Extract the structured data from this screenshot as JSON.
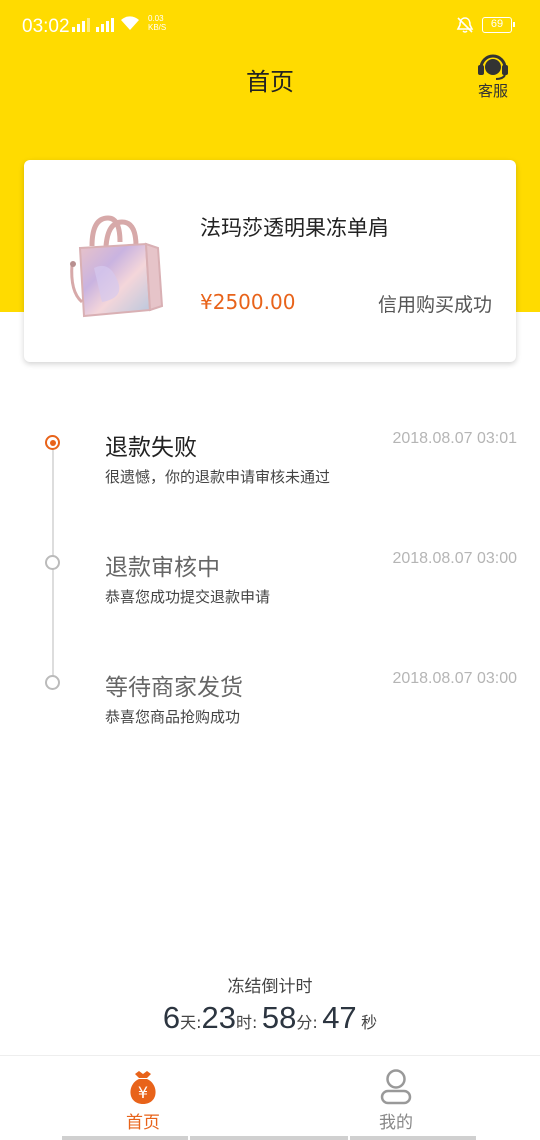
{
  "status_bar": {
    "time": "03:02",
    "network_speed": "0.03",
    "network_speed_unit": "KB/S",
    "battery": "69"
  },
  "header": {
    "title": "首页",
    "service_label": "客服"
  },
  "product": {
    "name": "法玛莎透明果冻单肩",
    "price": "¥2500.00",
    "status": "信用购买成功"
  },
  "timeline": [
    {
      "title": "退款失败",
      "desc": "很遗憾，你的退款申请审核未通过",
      "time": "2018.08.07 03:01",
      "active": true
    },
    {
      "title": "退款审核中",
      "desc": "恭喜您成功提交退款申请",
      "time": "2018.08.07 03:00",
      "active": false
    },
    {
      "title": "等待商家发货",
      "desc": "恭喜您商品抢购成功",
      "time": "2018.08.07 03:00",
      "active": false
    }
  ],
  "countdown": {
    "label": "冻结倒计时",
    "days": "6",
    "days_unit": "天:",
    "hours": "23",
    "hours_unit": "时:",
    "minutes": "58",
    "minutes_unit": "分:",
    "seconds": "47",
    "seconds_unit": "秒"
  },
  "bottom_nav": {
    "home_label": "首页",
    "home_icon_glyph": "¥",
    "mine_label": "我的"
  },
  "colors": {
    "brand_yellow": "#FFDB00",
    "accent_orange": "#E8631A"
  }
}
